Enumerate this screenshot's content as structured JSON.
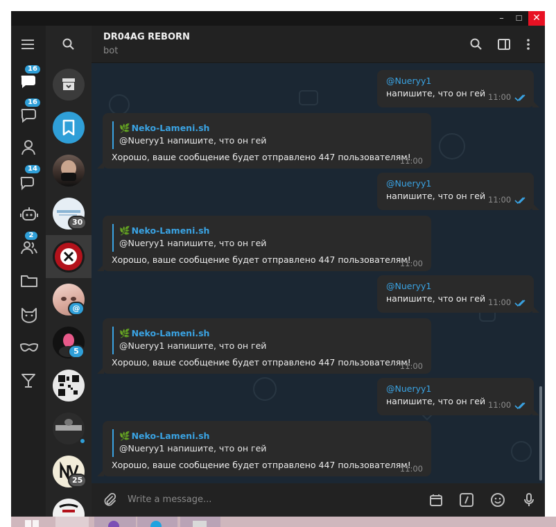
{
  "window": {
    "controls": {
      "minimize": "–",
      "maximize": "☐",
      "close": "✕"
    }
  },
  "rail": {
    "items": [
      {
        "icon": "hamburger-menu-icon",
        "badge": ""
      },
      {
        "icon": "all-chats-icon",
        "badge": "16"
      },
      {
        "icon": "unread-chats-icon",
        "badge": "16"
      },
      {
        "icon": "person-icon",
        "badge": ""
      },
      {
        "icon": "group-chat-icon",
        "badge": "14"
      },
      {
        "icon": "bot-icon",
        "badge": ""
      },
      {
        "icon": "users-icon",
        "badge": "2"
      },
      {
        "icon": "folder-icon",
        "badge": ""
      },
      {
        "icon": "cat-icon",
        "badge": ""
      },
      {
        "icon": "mask-icon",
        "badge": ""
      },
      {
        "icon": "cocktail-icon",
        "badge": ""
      }
    ]
  },
  "chatlist": {
    "items": [
      {
        "kind": "archive",
        "badge": ""
      },
      {
        "kind": "saved",
        "badge": ""
      },
      {
        "kind": "photo",
        "badge": ""
      },
      {
        "kind": "photo",
        "badge": "30"
      },
      {
        "kind": "photo",
        "badge": ""
      },
      {
        "kind": "photo",
        "badge": "@"
      },
      {
        "kind": "photo",
        "badge": "5"
      },
      {
        "kind": "photo",
        "badge": ""
      },
      {
        "kind": "photo",
        "badge": ""
      },
      {
        "kind": "photo",
        "badge": "25"
      },
      {
        "kind": "photo",
        "badge": ""
      }
    ]
  },
  "header": {
    "title": "DR04AG REBORN",
    "subtitle": "bot"
  },
  "messages": [
    {
      "dir": "out",
      "mention": "@Nueryy1",
      "text": "напишите, что он гей",
      "time": "11:00"
    },
    {
      "dir": "in",
      "reply_name": "Neko-Lameni.sh",
      "reply_text": "@Nueryy1 напишите, что он гей",
      "text": "Хорошо, ваше сообщение будет отправлено 447 пользователям!",
      "time": "11:00"
    },
    {
      "dir": "out",
      "mention": "@Nueryy1",
      "text": "напишите, что он гей",
      "time": "11:00"
    },
    {
      "dir": "in",
      "reply_name": "Neko-Lameni.sh",
      "reply_text": "@Nueryy1 напишите, что он гей",
      "text": "Хорошо, ваше сообщение будет отправлено 447 пользователям!",
      "time": "11:00"
    },
    {
      "dir": "out",
      "mention": "@Nueryy1",
      "text": "напишите, что он гей",
      "time": "11:00"
    },
    {
      "dir": "in",
      "reply_name": "Neko-Lameni.sh",
      "reply_text": "@Nueryy1 напишите, что он гей",
      "text": "Хорошо, ваше сообщение будет отправлено 447 пользователям!",
      "time": "11:00"
    },
    {
      "dir": "out",
      "mention": "@Nueryy1",
      "text": "напишите, что он гей",
      "time": "11:00"
    },
    {
      "dir": "in",
      "reply_name": "Neko-Lameni.sh",
      "reply_text": "@Nueryy1 напишите, что он гей",
      "text": "Хорошо, ваше сообщение будет отправлено 447 пользователям!",
      "time": "11:00"
    }
  ],
  "composer": {
    "placeholder": "Write a message..."
  },
  "colors": {
    "accent": "#3aa3e3",
    "badge": "#2f9fd8",
    "chat_bg": "#1b2733",
    "bubble": "#2a2a2a",
    "close": "#e81123"
  }
}
